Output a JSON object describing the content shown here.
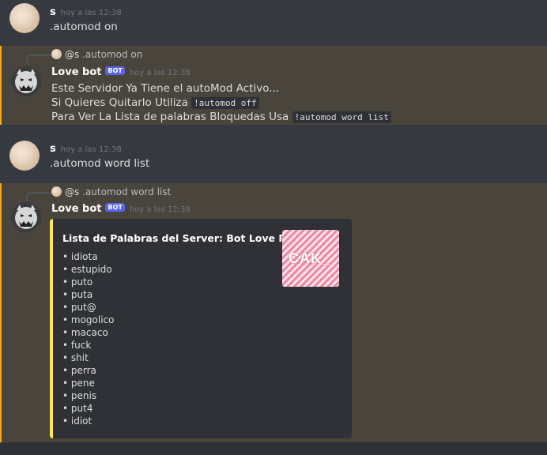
{
  "messages": {
    "m1": {
      "author": "s",
      "timestamp": "hoy a las 12:38",
      "text": ".automod on"
    },
    "m2": {
      "reply": {
        "author": "@s",
        "text": ".automod on"
      },
      "author": "Love bot",
      "bot_tag": "BOT",
      "timestamp": "hoy a las 12:38",
      "line1": "Este Servidor Ya Tiene el autoMod Activo...",
      "line2_text": "Si Quieres Quitarlo Utiliza",
      "line2_code": "!automod off",
      "line3_text": "Para Ver La Lista de palabras Bloquedas Usa",
      "line3_code": "!automod word list"
    },
    "m3": {
      "author": "s",
      "timestamp": "hoy a las 12:38",
      "text": ".automod word list"
    },
    "m4": {
      "reply": {
        "author": "@s",
        "text": ".automod word list"
      },
      "author": "Love bot",
      "bot_tag": "BOT",
      "timestamp": "hoy a las 12:38",
      "embed": {
        "title": "Lista de Palabras del Server: Bot Love Replit",
        "thumbnail_text": "CAK_",
        "items": [
          "• idiota",
          "• estupido",
          "• puto",
          "• puta",
          "• put@",
          "• mogolico",
          "• macaco",
          "• fuck",
          "• shit",
          "• perra",
          "• pene",
          "• penis",
          "• put4",
          "• idiot"
        ]
      }
    }
  },
  "colors": {
    "background": "#36393f",
    "mention_bg": "#49443c",
    "embed_accent": "#fee75c",
    "bot_tag": "#5865f2"
  }
}
